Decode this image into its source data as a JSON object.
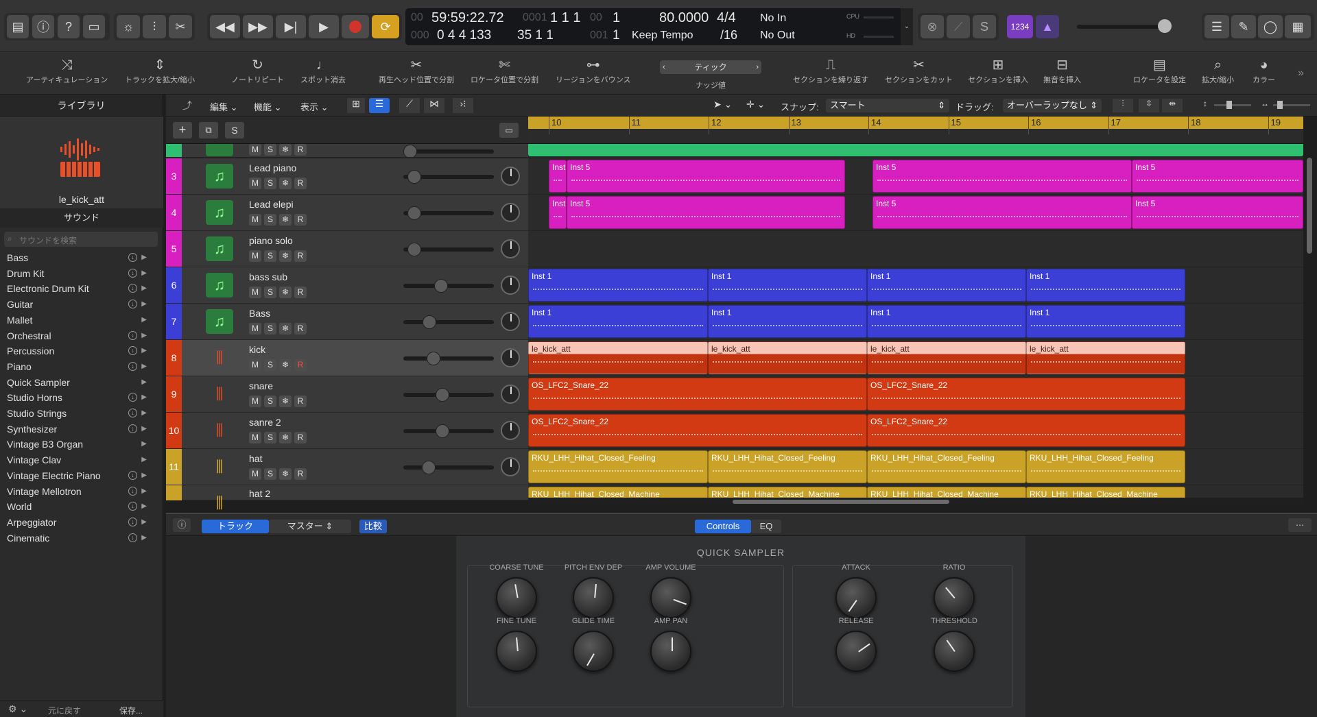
{
  "transport": {
    "time": "59:59:22.72",
    "time_prefix": "00",
    "bars_top": "1  1  1",
    "bars_top_prefix": "0001",
    "beat_top": "1",
    "beat_top_prefix": "00",
    "subframe": "0  4  4  133",
    "subframe_prefix": "000",
    "bars_bottom": "35  1  1",
    "bars_bottom_prefix": "00",
    "beat_bottom": "1",
    "beat_bottom_prefix": "001",
    "tempo": "80.0000",
    "tempo_mode": "Keep Tempo",
    "sig": "4/4",
    "division": "/16",
    "midi_in": "No In",
    "midi_out": "No Out",
    "cpu_label": "CPU",
    "hd_label": "HD",
    "count_in": "1234"
  },
  "toolbar": {
    "tools": [
      {
        "label": "アーティキュレーション",
        "icon": "articulation-icon"
      },
      {
        "label": "トラックを拡大/縮小",
        "icon": "zoom-track-icon"
      },
      {
        "label": "ノートリピート",
        "icon": "note-repeat-icon"
      },
      {
        "label": "スポット消去",
        "icon": "spot-erase-icon"
      },
      {
        "label": "再生ヘッド位置で分割",
        "icon": "split-playhead-icon"
      },
      {
        "label": "ロケータ位置で分割",
        "icon": "split-locator-icon"
      },
      {
        "label": "リージョンをバウンス",
        "icon": "bounce-region-icon"
      },
      {
        "label": "ナッジ値",
        "icon": "nudge-icon"
      },
      {
        "label": "セクションを繰り返す",
        "icon": "repeat-section-icon"
      },
      {
        "label": "セクションをカット",
        "icon": "cut-section-icon"
      },
      {
        "label": "セクションを挿入",
        "icon": "insert-section-icon"
      },
      {
        "label": "無音を挿入",
        "icon": "insert-silence-icon"
      },
      {
        "label": "ロケータを設定",
        "icon": "set-locator-icon"
      },
      {
        "label": "拡大/縮小",
        "icon": "zoom-icon"
      },
      {
        "label": "カラー",
        "icon": "palette-icon"
      }
    ],
    "nudge_value": "ティック"
  },
  "library": {
    "title": "ライブラリ",
    "patch_name": "le_kick_att",
    "sound_heading": "サウンド",
    "search_placeholder": "サウンドを検索",
    "categories": [
      {
        "name": "Bass",
        "dl": true
      },
      {
        "name": "Drum Kit",
        "dl": true
      },
      {
        "name": "Electronic Drum Kit",
        "dl": true
      },
      {
        "name": "Guitar",
        "dl": true
      },
      {
        "name": "Mallet",
        "dl": false
      },
      {
        "name": "Orchestral",
        "dl": true
      },
      {
        "name": "Percussion",
        "dl": true
      },
      {
        "name": "Piano",
        "dl": true
      },
      {
        "name": "Quick Sampler",
        "dl": false
      },
      {
        "name": "Studio Horns",
        "dl": true
      },
      {
        "name": "Studio Strings",
        "dl": true
      },
      {
        "name": "Synthesizer",
        "dl": true
      },
      {
        "name": "Vintage B3 Organ",
        "dl": false
      },
      {
        "name": "Vintage Clav",
        "dl": false
      },
      {
        "name": "Vintage Electric Piano",
        "dl": true
      },
      {
        "name": "Vintage Mellotron",
        "dl": true
      },
      {
        "name": "World",
        "dl": true
      },
      {
        "name": "Arpeggiator",
        "dl": true
      },
      {
        "name": "Cinematic",
        "dl": true
      }
    ],
    "footer_revert": "元に戻す",
    "footer_save": "保存..."
  },
  "track_menu": {
    "edit": "編集",
    "function": "機能",
    "view": "表示",
    "snap_label": "スナップ:",
    "snap_value": "スマート",
    "drag_label": "ドラッグ:",
    "drag_value": "オーバーラップなし",
    "header_s": "S"
  },
  "ruler": [
    "10",
    "11",
    "12",
    "13",
    "14",
    "15",
    "16",
    "17",
    "18",
    "19"
  ],
  "tracks": [
    {
      "num": "3",
      "name": "Lead piano",
      "color": "#d81fbf",
      "kind": "midi",
      "vol": 0.05,
      "r_active": false
    },
    {
      "num": "4",
      "name": "Lead elepi",
      "color": "#d81fbf",
      "kind": "midi",
      "vol": 0.05,
      "r_active": false
    },
    {
      "num": "5",
      "name": "piano solo",
      "color": "#d81fbf",
      "kind": "midi",
      "vol": 0.05,
      "r_active": false
    },
    {
      "num": "6",
      "name": "bass sub",
      "color": "#3b3fd6",
      "kind": "midi",
      "vol": 0.4,
      "r_active": false
    },
    {
      "num": "7",
      "name": "Bass",
      "color": "#3b3fd6",
      "kind": "midi",
      "vol": 0.25,
      "r_active": false
    },
    {
      "num": "8",
      "name": "kick",
      "color": "#d13a12",
      "kind": "audio",
      "vol": 0.3,
      "r_active": true
    },
    {
      "num": "9",
      "name": "snare",
      "color": "#d13a12",
      "kind": "audio",
      "vol": 0.42,
      "r_active": false
    },
    {
      "num": "10",
      "name": "sanre 2",
      "color": "#d13a12",
      "kind": "audio",
      "vol": 0.42,
      "r_active": false
    },
    {
      "num": "11",
      "name": "hat",
      "color": "#c9a227",
      "kind": "audio",
      "vol": 0.24,
      "r_active": false
    },
    {
      "num": "",
      "name": "hat 2",
      "color": "#c9a227",
      "kind": "audio",
      "vol": 0.24,
      "r_active": false
    }
  ],
  "msr": {
    "m": "M",
    "s": "S",
    "f": "❄",
    "r": "R"
  },
  "regions": {
    "row3": [
      "Inst",
      "Inst 5",
      "Inst 5",
      "Inst 5"
    ],
    "row4": [
      "Inst",
      "Inst 5",
      "Inst 5",
      "Inst 5"
    ],
    "row6": [
      "Inst 1",
      "Inst 1",
      "Inst 1",
      "Inst 1"
    ],
    "row7": [
      "Inst 1",
      "Inst 1",
      "Inst 1",
      "Inst 1"
    ],
    "row8": [
      "le_kick_att",
      "le_kick_att",
      "le_kick_att",
      "le_kick_att"
    ],
    "row9": [
      "OS_LFC2_Snare_22",
      "OS_LFC2_Snare_22"
    ],
    "row10": [
      "OS_LFC2_Snare_22",
      "OS_LFC2_Snare_22"
    ],
    "row11": [
      "RKU_LHH_Hihat_Closed_Feeling",
      "RKU_LHH_Hihat_Closed_Feeling",
      "RKU_LHH_Hihat_Closed_Feeling",
      "RKU_LHH_Hihat_Closed_Feeling"
    ],
    "row12": [
      "RKU_LHH_Hihat_Closed_Machine",
      "RKU_LHH_Hihat_Closed_Machine",
      "RKU_LHH_Hihat_Closed_Machine",
      "RKU_LHH_Hihat_Closed_Machine"
    ]
  },
  "editor": {
    "tab_track": "トラック",
    "tab_master": "マスター",
    "compare": "比較",
    "controls": "Controls",
    "eq": "EQ",
    "title": "QUICK SAMPLER",
    "knobs_left": [
      "COARSE TUNE",
      "PITCH ENV DEP",
      "AMP VOLUME",
      "FINE TUNE",
      "GLIDE TIME",
      "AMP PAN"
    ],
    "knobs_right": [
      "ATTACK",
      "RATIO",
      "RELEASE",
      "THRESHOLD"
    ]
  },
  "colors": {
    "accent": "#2a6ad8",
    "loop": "#d6a020",
    "record": "#d1342a",
    "green_track": "#2fbf71"
  }
}
